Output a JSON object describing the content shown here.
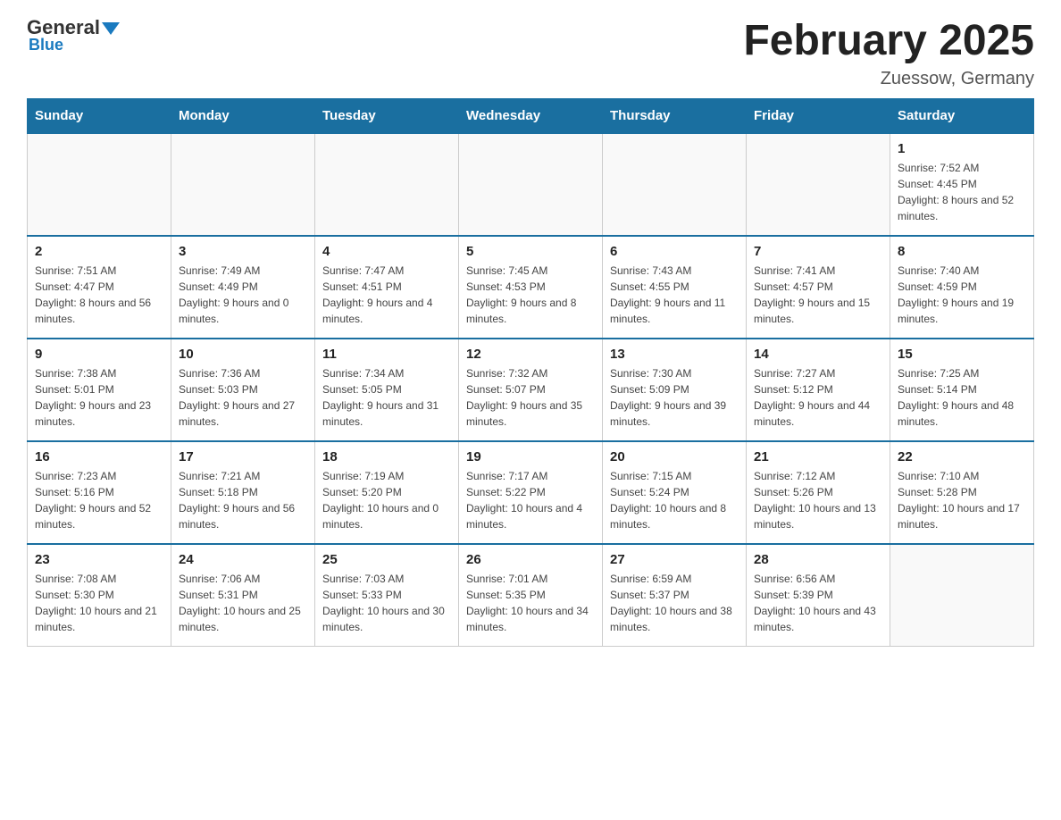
{
  "header": {
    "logo_line1_black": "General",
    "logo_line1_blue": "Blue",
    "logo_line2": "Blue",
    "month_title": "February 2025",
    "location": "Zuessow, Germany"
  },
  "days_of_week": [
    "Sunday",
    "Monday",
    "Tuesday",
    "Wednesday",
    "Thursday",
    "Friday",
    "Saturday"
  ],
  "weeks": [
    [
      {
        "day": "",
        "info": ""
      },
      {
        "day": "",
        "info": ""
      },
      {
        "day": "",
        "info": ""
      },
      {
        "day": "",
        "info": ""
      },
      {
        "day": "",
        "info": ""
      },
      {
        "day": "",
        "info": ""
      },
      {
        "day": "1",
        "info": "Sunrise: 7:52 AM\nSunset: 4:45 PM\nDaylight: 8 hours and 52 minutes."
      }
    ],
    [
      {
        "day": "2",
        "info": "Sunrise: 7:51 AM\nSunset: 4:47 PM\nDaylight: 8 hours and 56 minutes."
      },
      {
        "day": "3",
        "info": "Sunrise: 7:49 AM\nSunset: 4:49 PM\nDaylight: 9 hours and 0 minutes."
      },
      {
        "day": "4",
        "info": "Sunrise: 7:47 AM\nSunset: 4:51 PM\nDaylight: 9 hours and 4 minutes."
      },
      {
        "day": "5",
        "info": "Sunrise: 7:45 AM\nSunset: 4:53 PM\nDaylight: 9 hours and 8 minutes."
      },
      {
        "day": "6",
        "info": "Sunrise: 7:43 AM\nSunset: 4:55 PM\nDaylight: 9 hours and 11 minutes."
      },
      {
        "day": "7",
        "info": "Sunrise: 7:41 AM\nSunset: 4:57 PM\nDaylight: 9 hours and 15 minutes."
      },
      {
        "day": "8",
        "info": "Sunrise: 7:40 AM\nSunset: 4:59 PM\nDaylight: 9 hours and 19 minutes."
      }
    ],
    [
      {
        "day": "9",
        "info": "Sunrise: 7:38 AM\nSunset: 5:01 PM\nDaylight: 9 hours and 23 minutes."
      },
      {
        "day": "10",
        "info": "Sunrise: 7:36 AM\nSunset: 5:03 PM\nDaylight: 9 hours and 27 minutes."
      },
      {
        "day": "11",
        "info": "Sunrise: 7:34 AM\nSunset: 5:05 PM\nDaylight: 9 hours and 31 minutes."
      },
      {
        "day": "12",
        "info": "Sunrise: 7:32 AM\nSunset: 5:07 PM\nDaylight: 9 hours and 35 minutes."
      },
      {
        "day": "13",
        "info": "Sunrise: 7:30 AM\nSunset: 5:09 PM\nDaylight: 9 hours and 39 minutes."
      },
      {
        "day": "14",
        "info": "Sunrise: 7:27 AM\nSunset: 5:12 PM\nDaylight: 9 hours and 44 minutes."
      },
      {
        "day": "15",
        "info": "Sunrise: 7:25 AM\nSunset: 5:14 PM\nDaylight: 9 hours and 48 minutes."
      }
    ],
    [
      {
        "day": "16",
        "info": "Sunrise: 7:23 AM\nSunset: 5:16 PM\nDaylight: 9 hours and 52 minutes."
      },
      {
        "day": "17",
        "info": "Sunrise: 7:21 AM\nSunset: 5:18 PM\nDaylight: 9 hours and 56 minutes."
      },
      {
        "day": "18",
        "info": "Sunrise: 7:19 AM\nSunset: 5:20 PM\nDaylight: 10 hours and 0 minutes."
      },
      {
        "day": "19",
        "info": "Sunrise: 7:17 AM\nSunset: 5:22 PM\nDaylight: 10 hours and 4 minutes."
      },
      {
        "day": "20",
        "info": "Sunrise: 7:15 AM\nSunset: 5:24 PM\nDaylight: 10 hours and 8 minutes."
      },
      {
        "day": "21",
        "info": "Sunrise: 7:12 AM\nSunset: 5:26 PM\nDaylight: 10 hours and 13 minutes."
      },
      {
        "day": "22",
        "info": "Sunrise: 7:10 AM\nSunset: 5:28 PM\nDaylight: 10 hours and 17 minutes."
      }
    ],
    [
      {
        "day": "23",
        "info": "Sunrise: 7:08 AM\nSunset: 5:30 PM\nDaylight: 10 hours and 21 minutes."
      },
      {
        "day": "24",
        "info": "Sunrise: 7:06 AM\nSunset: 5:31 PM\nDaylight: 10 hours and 25 minutes."
      },
      {
        "day": "25",
        "info": "Sunrise: 7:03 AM\nSunset: 5:33 PM\nDaylight: 10 hours and 30 minutes."
      },
      {
        "day": "26",
        "info": "Sunrise: 7:01 AM\nSunset: 5:35 PM\nDaylight: 10 hours and 34 minutes."
      },
      {
        "day": "27",
        "info": "Sunrise: 6:59 AM\nSunset: 5:37 PM\nDaylight: 10 hours and 38 minutes."
      },
      {
        "day": "28",
        "info": "Sunrise: 6:56 AM\nSunset: 5:39 PM\nDaylight: 10 hours and 43 minutes."
      },
      {
        "day": "",
        "info": ""
      }
    ]
  ]
}
